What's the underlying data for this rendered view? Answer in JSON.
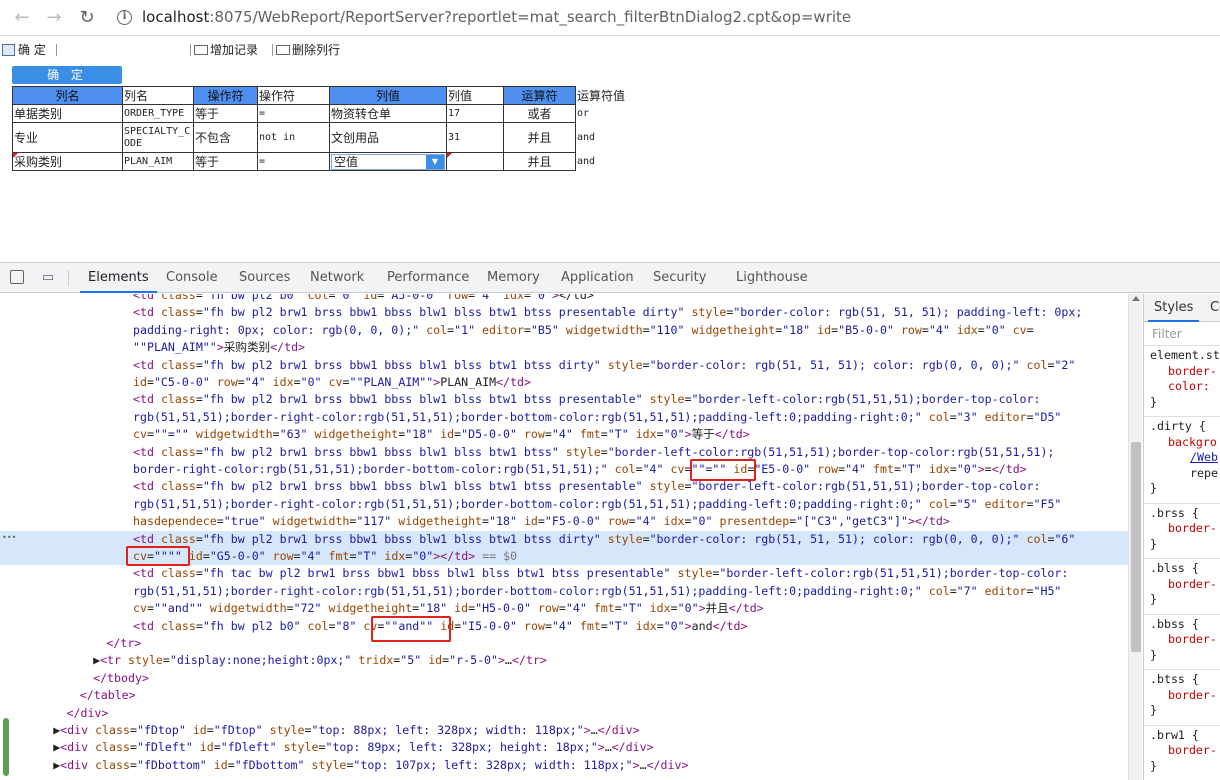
{
  "browser": {
    "url_host": "localhost",
    "url_rest": ":8075/WebReport/ReportServer?reportlet=mat_search_filterBtnDialog2.cpt&op=write",
    "back_glyph": "←",
    "forward_glyph": "→",
    "reload_glyph": "↻",
    "info_glyph": "i"
  },
  "toolbar": {
    "ok_label": "确 定",
    "add_label": "增加记录",
    "delete_label": "删除列行"
  },
  "report": {
    "confirm_button": "确 定",
    "header": [
      "列名",
      "列名",
      "操作符",
      "操作符",
      "列值",
      "列值",
      "运算符",
      "运算符值"
    ],
    "rows": [
      [
        "单据类别",
        "ORDER_TYPE",
        "等于",
        "=",
        "物资转仓单",
        "17",
        "或者",
        "or"
      ],
      [
        "专业",
        "SPECIALTY_CODE",
        "不包含",
        "not in",
        "文创用品",
        "31",
        "并且",
        "and"
      ],
      [
        "采购类别",
        "PLAN_AIM",
        "等于",
        "=",
        "空值",
        "",
        "并且",
        "and"
      ]
    ]
  },
  "devtools": {
    "tabs": [
      "Elements",
      "Console",
      "Sources",
      "Network",
      "Performance",
      "Memory",
      "Application",
      "Security",
      "Lighthouse"
    ],
    "active_tab": "Elements",
    "styles_tabs": [
      "Styles",
      "Co"
    ],
    "filter_placeholder": "Filter",
    "code_lines": [
      {
        "indent": 10,
        "html": "<span class=\"tag\">&lt;td</span> <span class=\"an\">class</span>=<span class=\"av\">\"fh bw pl2 b0\"</span> <span class=\"an\">col</span>=<span class=\"av\">\"0\"</span> <span class=\"an\">id</span>=<span class=\"av\">\"A5-0-0\"</span> <span class=\"an\">row</span>=<span class=\"av\">\"4\"</span> <span class=\"an\">idx</span>=<span class=\"av\">\"0\"</span><span class=\"tag\">&gt;</span>&lt;/td&gt;"
      },
      {
        "indent": 10,
        "html": "<span class=\"tag\">&lt;td</span> <span class=\"an\">class</span>=<span class=\"av\">\"fh bw pl2 brw1 brss bbw1 bbss blw1 blss btw1 btss presentable dirty\"</span> <span class=\"an\">style</span>=<span class=\"av\">\"border-color: rgb(51, 51, 51); padding-left: 0px;</span>"
      },
      {
        "indent": 10,
        "html": "<span class=\"av\">padding-right: 0px; color: rgb(0, 0, 0);\"</span> <span class=\"an\">col</span>=<span class=\"av\">\"1\"</span> <span class=\"an\">editor</span>=<span class=\"av\">\"B5\"</span> <span class=\"an\">widgetwidth</span>=<span class=\"av\">\"110\"</span> <span class=\"an\">widgetheight</span>=<span class=\"av\">\"18\"</span> <span class=\"an\">id</span>=<span class=\"av\">\"B5-0-0\"</span> <span class=\"an\">row</span>=<span class=\"av\">\"4\"</span> <span class=\"an\">idx</span>=<span class=\"av\">\"0\"</span> <span class=\"an\">cv</span>="
      },
      {
        "indent": 10,
        "html": "<span class=\"av\">\"\"PLAN_AIM\"\"</span><span class=\"tag\">&gt;</span>采购类别<span class=\"tag\">&lt;/td&gt;</span>"
      },
      {
        "indent": 10,
        "html": "<span class=\"tag\">&lt;td</span> <span class=\"an\">class</span>=<span class=\"av\">\"fh bw pl2 brw1 brss bbw1 bbss blw1 blss btw1 btss dirty\"</span> <span class=\"an\">style</span>=<span class=\"av\">\"border-color: rgb(51, 51, 51); color: rgb(0, 0, 0);\"</span> <span class=\"an\">col</span>=<span class=\"av\">\"2\"</span>"
      },
      {
        "indent": 10,
        "html": "<span class=\"an\">id</span>=<span class=\"av\">\"C5-0-0\"</span> <span class=\"an\">row</span>=<span class=\"av\">\"4\"</span> <span class=\"an\">idx</span>=<span class=\"av\">\"0\"</span> <span class=\"an\">cv</span>=<span class=\"av\">\"\"PLAN_AIM\"\"</span><span class=\"tag\">&gt;</span>PLAN_AIM<span class=\"tag\">&lt;/td&gt;</span>"
      },
      {
        "indent": 10,
        "html": "<span class=\"tag\">&lt;td</span> <span class=\"an\">class</span>=<span class=\"av\">\"fh bw pl2 brw1 brss bbw1 bbss blw1 blss btw1 btss presentable\"</span> <span class=\"an\">style</span>=<span class=\"av\">\"border-left-color:rgb(51,51,51);border-top-color:</span>"
      },
      {
        "indent": 10,
        "html": "<span class=\"av\">rgb(51,51,51);border-right-color:rgb(51,51,51);border-bottom-color:rgb(51,51,51);padding-left:0;padding-right:0;\"</span> <span class=\"an\">col</span>=<span class=\"av\">\"3\"</span> <span class=\"an\">editor</span>=<span class=\"av\">\"D5\"</span>"
      },
      {
        "indent": 10,
        "html": "<span class=\"an\">cv</span>=<span class=\"av\">\"\"=\"\"</span> <span class=\"an\">widgetwidth</span>=<span class=\"av\">\"63\"</span> <span class=\"an\">widgetheight</span>=<span class=\"av\">\"18\"</span> <span class=\"an\">id</span>=<span class=\"av\">\"D5-0-0\"</span> <span class=\"an\">row</span>=<span class=\"av\">\"4\"</span> <span class=\"an\">fmt</span>=<span class=\"av\">\"T\"</span> <span class=\"an\">idx</span>=<span class=\"av\">\"0\"</span><span class=\"tag\">&gt;</span>等于<span class=\"tag\">&lt;/td&gt;</span>"
      },
      {
        "indent": 10,
        "html": "<span class=\"tag\">&lt;td</span> <span class=\"an\">class</span>=<span class=\"av\">\"fh bw pl2 brw1 brss bbw1 bbss blw1 blss btw1 btss\"</span> <span class=\"an\">style</span>=<span class=\"av\">\"border-left-color:rgb(51,51,51);border-top-color:rgb(51,51,51);</span>"
      },
      {
        "indent": 10,
        "html": "<span class=\"av\">border-right-color:rgb(51,51,51);border-bottom-color:rgb(51,51,51);\"</span> <span class=\"an\">col</span>=<span class=\"av\">\"4\"</span> <span class=\"an\">cv</span>=<span class=\"av\">\"\"=\"\"</span> <span class=\"an\">id</span>=<span class=\"av\">\"E5-0-0\"</span> <span class=\"an\">row</span>=<span class=\"av\">\"4\"</span> <span class=\"an\">fmt</span>=<span class=\"av\">\"T\"</span> <span class=\"an\">idx</span>=<span class=\"av\">\"0\"</span><span class=\"tag\">&gt;</span>=<span class=\"tag\">&lt;/td&gt;</span>"
      },
      {
        "indent": 10,
        "html": "<span class=\"tag\">&lt;td</span> <span class=\"an\">class</span>=<span class=\"av\">\"fh bw pl2 brw1 brss bbw1 bbss blw1 blss btw1 btss presentable\"</span> <span class=\"an\">style</span>=<span class=\"av\">\"border-left-color:rgb(51,51,51);border-top-color:</span>"
      },
      {
        "indent": 10,
        "html": "<span class=\"av\">rgb(51,51,51);border-right-color:rgb(51,51,51);border-bottom-color:rgb(51,51,51);padding-left:0;padding-right:0;\"</span> <span class=\"an\">col</span>=<span class=\"av\">\"5\"</span> <span class=\"an\">editor</span>=<span class=\"av\">\"F5\"</span>"
      },
      {
        "indent": 10,
        "html": "<span class=\"an\">hasdependece</span>=<span class=\"av\">\"true\"</span> <span class=\"an\">widgetwidth</span>=<span class=\"av\">\"117\"</span> <span class=\"an\">widgetheight</span>=<span class=\"av\">\"18\"</span> <span class=\"an\">id</span>=<span class=\"av\">\"F5-0-0\"</span> <span class=\"an\">row</span>=<span class=\"av\">\"4\"</span> <span class=\"an\">idx</span>=<span class=\"av\">\"0\"</span> <span class=\"an\">presentdep</span>=<span class=\"av\">\"[\"C3\",\"getC3\"]\"</span><span class=\"tag\">&gt;&lt;/td&gt;</span>"
      },
      {
        "indent": 10,
        "hl": true,
        "html": "<span class=\"tag\">&lt;td</span> <span class=\"an\">class</span>=<span class=\"av\">\"fh bw pl2 brw1 brss bbw1 bbss blw1 blss btw1 btss dirty\"</span> <span class=\"an\">style</span>=<span class=\"av\">\"border-color: rgb(51, 51, 51); color: rgb(0, 0, 0);\"</span> <span class=\"an\">col</span>=<span class=\"av\">\"6\"</span>"
      },
      {
        "indent": 10,
        "hl": true,
        "html": "<span class=\"an\">cv</span>=<span class=\"av\">\"\"\"\"</span> <span class=\"an\">id</span>=<span class=\"av\">\"G5-0-0\"</span> <span class=\"an\">row</span>=<span class=\"av\">\"4\"</span> <span class=\"an\">fmt</span>=<span class=\"av\">\"T\"</span> <span class=\"an\">idx</span>=<span class=\"av\">\"0\"</span><span class=\"tag\">&gt;&lt;/td&gt;</span> <span class=\"dollar\">== $0</span>"
      },
      {
        "indent": 10,
        "html": "<span class=\"tag\">&lt;td</span> <span class=\"an\">class</span>=<span class=\"av\">\"fh tac bw pl2 brw1 brss bbw1 bbss blw1 blss btw1 btss presentable\"</span> <span class=\"an\">style</span>=<span class=\"av\">\"border-left-color:rgb(51,51,51);border-top-color:</span>"
      },
      {
        "indent": 10,
        "html": "<span class=\"av\">rgb(51,51,51);border-right-color:rgb(51,51,51);border-bottom-color:rgb(51,51,51);padding-left:0;padding-right:0;\"</span> <span class=\"an\">col</span>=<span class=\"av\">\"7\"</span> <span class=\"an\">editor</span>=<span class=\"av\">\"H5\"</span>"
      },
      {
        "indent": 10,
        "html": "<span class=\"an\">cv</span>=<span class=\"av\">\"\"and\"\"</span> <span class=\"an\">widgetwidth</span>=<span class=\"av\">\"72\"</span> <span class=\"an\">widgetheight</span>=<span class=\"av\">\"18\"</span> <span class=\"an\">id</span>=<span class=\"av\">\"H5-0-0\"</span> <span class=\"an\">row</span>=<span class=\"av\">\"4\"</span> <span class=\"an\">fmt</span>=<span class=\"av\">\"T\"</span> <span class=\"an\">idx</span>=<span class=\"av\">\"0\"</span><span class=\"tag\">&gt;</span>并且<span class=\"tag\">&lt;/td&gt;</span>"
      },
      {
        "indent": 10,
        "html": "<span class=\"tag\">&lt;td</span> <span class=\"an\">class</span>=<span class=\"av\">\"fh bw pl2 b0\"</span> <span class=\"an\">col</span>=<span class=\"av\">\"8\"</span> <span class=\"an\">cv</span>=<span class=\"av\">\"\"and\"\"</span> <span class=\"an\">id</span>=<span class=\"av\">\"I5-0-0\"</span> <span class=\"an\">row</span>=<span class=\"av\">\"4\"</span> <span class=\"an\">fmt</span>=<span class=\"av\">\"T\"</span> <span class=\"an\">idx</span>=<span class=\"av\">\"0\"</span><span class=\"tag\">&gt;</span>and<span class=\"tag\">&lt;/td&gt;</span>"
      },
      {
        "indent": 8,
        "html": "<span class=\"tag\">&lt;/tr&gt;</span>"
      },
      {
        "indent": 7,
        "html": "▶<span class=\"tag\">&lt;tr</span> <span class=\"an\">style</span>=<span class=\"av\">\"display:none;height:0px;\"</span> <span class=\"an\">tridx</span>=<span class=\"av\">\"5\"</span> <span class=\"an\">id</span>=<span class=\"av\">\"r-5-0\"</span><span class=\"tag\">&gt;</span>…<span class=\"tag\">&lt;/tr&gt;</span>"
      },
      {
        "indent": 7,
        "html": "<span class=\"tag\">&lt;/tbody&gt;</span>"
      },
      {
        "indent": 6,
        "html": "<span class=\"tag\">&lt;/table&gt;</span>"
      },
      {
        "indent": 5,
        "html": "<span class=\"tag\">&lt;/div&gt;</span>"
      },
      {
        "indent": 4,
        "html": "▶<span class=\"tag\">&lt;div</span> <span class=\"an\">class</span>=<span class=\"av\">\"fDtop\"</span> <span class=\"an\">id</span>=<span class=\"av\">\"fDtop\"</span> <span class=\"an\">style</span>=<span class=\"av\">\"top: 88px; left: 328px; width: 118px;\"</span><span class=\"tag\">&gt;</span>…<span class=\"tag\">&lt;/div&gt;</span>"
      },
      {
        "indent": 4,
        "html": "▶<span class=\"tag\">&lt;div</span> <span class=\"an\">class</span>=<span class=\"av\">\"fDleft\"</span> <span class=\"an\">id</span>=<span class=\"av\">\"fDleft\"</span> <span class=\"an\">style</span>=<span class=\"av\">\"top: 89px; left: 328px; height: 18px;\"</span><span class=\"tag\">&gt;</span>…<span class=\"tag\">&lt;/div&gt;</span>"
      },
      {
        "indent": 4,
        "html": "▶<span class=\"tag\">&lt;div</span> <span class=\"an\">class</span>=<span class=\"av\">\"fDbottom\"</span> <span class=\"an\">id</span>=<span class=\"av\">\"fDbottom\"</span> <span class=\"an\">style</span>=<span class=\"av\">\"top: 107px; left: 328px; width: 118px;\"</span><span class=\"tag\">&gt;</span>…<span class=\"tag\">&lt;/div&gt;</span>"
      }
    ],
    "styles_rules": [
      {
        "sel": "element.st",
        "props": [
          "border-",
          "color:"
        ]
      },
      {
        "sel": ".dirty {",
        "props": [
          "backgro"
        ],
        "link": "/Web",
        "val": "repe"
      },
      {
        "sel": ".brss {",
        "props": [
          "border-"
        ]
      },
      {
        "sel": ".blss {",
        "props": [
          "border-"
        ]
      },
      {
        "sel": ".bbss {",
        "props": [
          "border-"
        ]
      },
      {
        "sel": ".btss {",
        "props": [
          "border-"
        ]
      },
      {
        "sel": ".brw1 {",
        "props": [
          "border-"
        ]
      }
    ]
  }
}
